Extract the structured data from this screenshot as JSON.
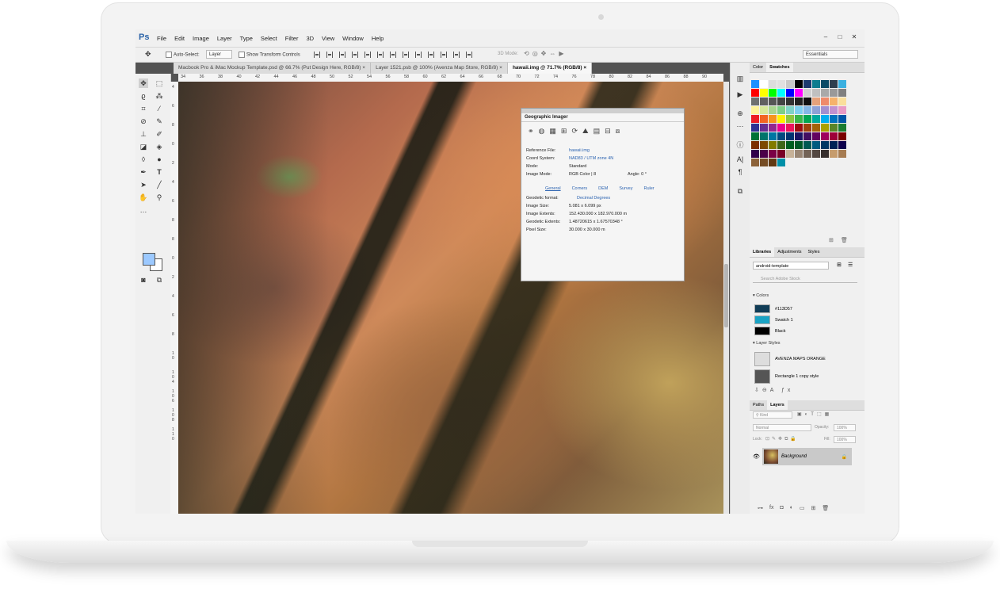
{
  "app": {
    "logo": "Ps"
  },
  "menu": [
    "File",
    "Edit",
    "Image",
    "Layer",
    "Type",
    "Select",
    "Filter",
    "3D",
    "View",
    "Window",
    "Help"
  ],
  "window_controls": [
    "–",
    "□",
    "✕"
  ],
  "options": {
    "auto_select_label": "Auto-Select:",
    "auto_select_value": "Layer",
    "transform_label": "Show Transform Controls",
    "mode_3d": "3D Mode:",
    "workspace": "Essentials"
  },
  "tabs": [
    "Macbook Pro & iMac Mockup Template.psd @ 66.7% (Put Design Here, RGB/8) ×",
    "Layer 1521.psb @ 100% (Avenza Map Store, RGB/8) ×",
    "hawaii.img @ 71.7% (RGB/8) ×"
  ],
  "ruler_top": [
    "34",
    "36",
    "38",
    "40",
    "42",
    "44",
    "46",
    "48",
    "50",
    "52",
    "54",
    "56",
    "58",
    "60",
    "62",
    "64",
    "66",
    "68",
    "70",
    "72",
    "74",
    "76",
    "78",
    "80",
    "82",
    "84",
    "86",
    "88",
    "90"
  ],
  "ruler_left": [
    "4",
    "6",
    "8",
    "0",
    "2",
    "4",
    "6",
    "8",
    "8",
    "0",
    "2",
    "4",
    "6",
    "8",
    "1 0",
    "1 0 4",
    "1 0 6",
    "1 0 8",
    "1 1 0"
  ],
  "geo": {
    "title": "Geographic Imager",
    "rows": [
      {
        "k": "Reference File:",
        "v": "hawaii.img"
      },
      {
        "k": "Coord System:",
        "v": "NAD83 / UTM zone 4N"
      },
      {
        "k": "Mode:",
        "v": "Standard"
      },
      {
        "k": "Image Mode:",
        "v": "RGB Color | 8"
      }
    ],
    "angle_label": "Angle:",
    "angle_value": "0 °",
    "subtabs": [
      "General",
      "Corners",
      "DEM",
      "Survey",
      "Ruler"
    ],
    "values": [
      {
        "k": "Geodetic format:",
        "v": "Decimal Degrees"
      },
      {
        "k": "Image Size:",
        "v": "5.081 x 6.099 px"
      },
      {
        "k": "Image Extents:",
        "v": "152.430.000 x 182.970.000 m"
      },
      {
        "k": "Geodetic Extents:",
        "v": "1.48720615 x 1.67570348 °"
      },
      {
        "k": "Pixel Size:",
        "v": "30.000 x 30.000 m"
      }
    ]
  },
  "swatches": {
    "tabs": [
      "Color",
      "Swatches"
    ],
    "colors": [
      "#1e90ff",
      "#ffffff",
      "#dddddd",
      "#e0e0e0",
      "#c8c8c8",
      "#000000",
      "#1d3a6e",
      "#0d7c8f",
      "#0b4a66",
      "#2e3e4e",
      "#3ab0e0",
      "#ff0000",
      "#ffff00",
      "#00ff00",
      "#00ffff",
      "#0000ff",
      "#ff00ff",
      "#d0d0d0",
      "#c0c0c0",
      "#a9a9a9",
      "#999999",
      "#808080",
      "#707070",
      "#606060",
      "#555555",
      "#444444",
      "#333333",
      "#222222",
      "#111111",
      "#e6a17a",
      "#ef8a6a",
      "#f6b26b",
      "#fadf9c",
      "#fff29a",
      "#d7e89a",
      "#a9d48f",
      "#7fcf86",
      "#7fd3c7",
      "#7fcff0",
      "#85b7e6",
      "#8fa1d6",
      "#a28fd0",
      "#c291d0",
      "#e99ac6",
      "#ed1c24",
      "#f26522",
      "#f7941d",
      "#fff200",
      "#8dc63f",
      "#39b54a",
      "#00a651",
      "#00a99d",
      "#00aeef",
      "#0072bc",
      "#0054a6",
      "#2e3192",
      "#662d91",
      "#92278f",
      "#ec008c",
      "#ed145b",
      "#9e0b0f",
      "#a0410d",
      "#a36209",
      "#aba000",
      "#598527",
      "#1a7b30",
      "#007236",
      "#00746b",
      "#0076a3",
      "#004a80",
      "#003471",
      "#1b1464",
      "#440e62",
      "#630460",
      "#9e005d",
      "#9e0039",
      "#790000",
      "#7b2e00",
      "#7d4900",
      "#827b00",
      "#406618",
      "#005e20",
      "#005826",
      "#005952",
      "#005b7f",
      "#003663",
      "#002157",
      "#0d004c",
      "#32004b",
      "#4b0049",
      "#7b0046",
      "#7a0026",
      "#c7b299",
      "#998675",
      "#736357",
      "#534741",
      "#362f2d",
      "#c69c6d",
      "#a67c52",
      "#8c6239",
      "#754c24",
      "#603913",
      "#0090a8"
    ]
  },
  "libraries": {
    "tabs": [
      "Libraries",
      "Adjustments",
      "Styles"
    ],
    "selected": "android-template",
    "search_placeholder": "Search Adobe Stock",
    "colors_header": "Colors",
    "colors": [
      {
        "name": "#113D57",
        "color": "#113D57"
      },
      {
        "name": "Swatch 1",
        "color": "#1aa3c4"
      },
      {
        "name": "Black",
        "color": "#000000"
      }
    ],
    "styles_header": "Layer Styles",
    "styles": [
      "AVENZA MAPS ORANGE",
      "Rectangle 1 copy style"
    ]
  },
  "layers": {
    "tabs": [
      "Paths",
      "Layers"
    ],
    "kind": "Kind",
    "blend": "Normal",
    "opacity_label": "Opacity:",
    "opacity": "100%",
    "lock_label": "Lock:",
    "fill_label": "Fill:",
    "fill": "100%",
    "layer_name": "Background"
  }
}
